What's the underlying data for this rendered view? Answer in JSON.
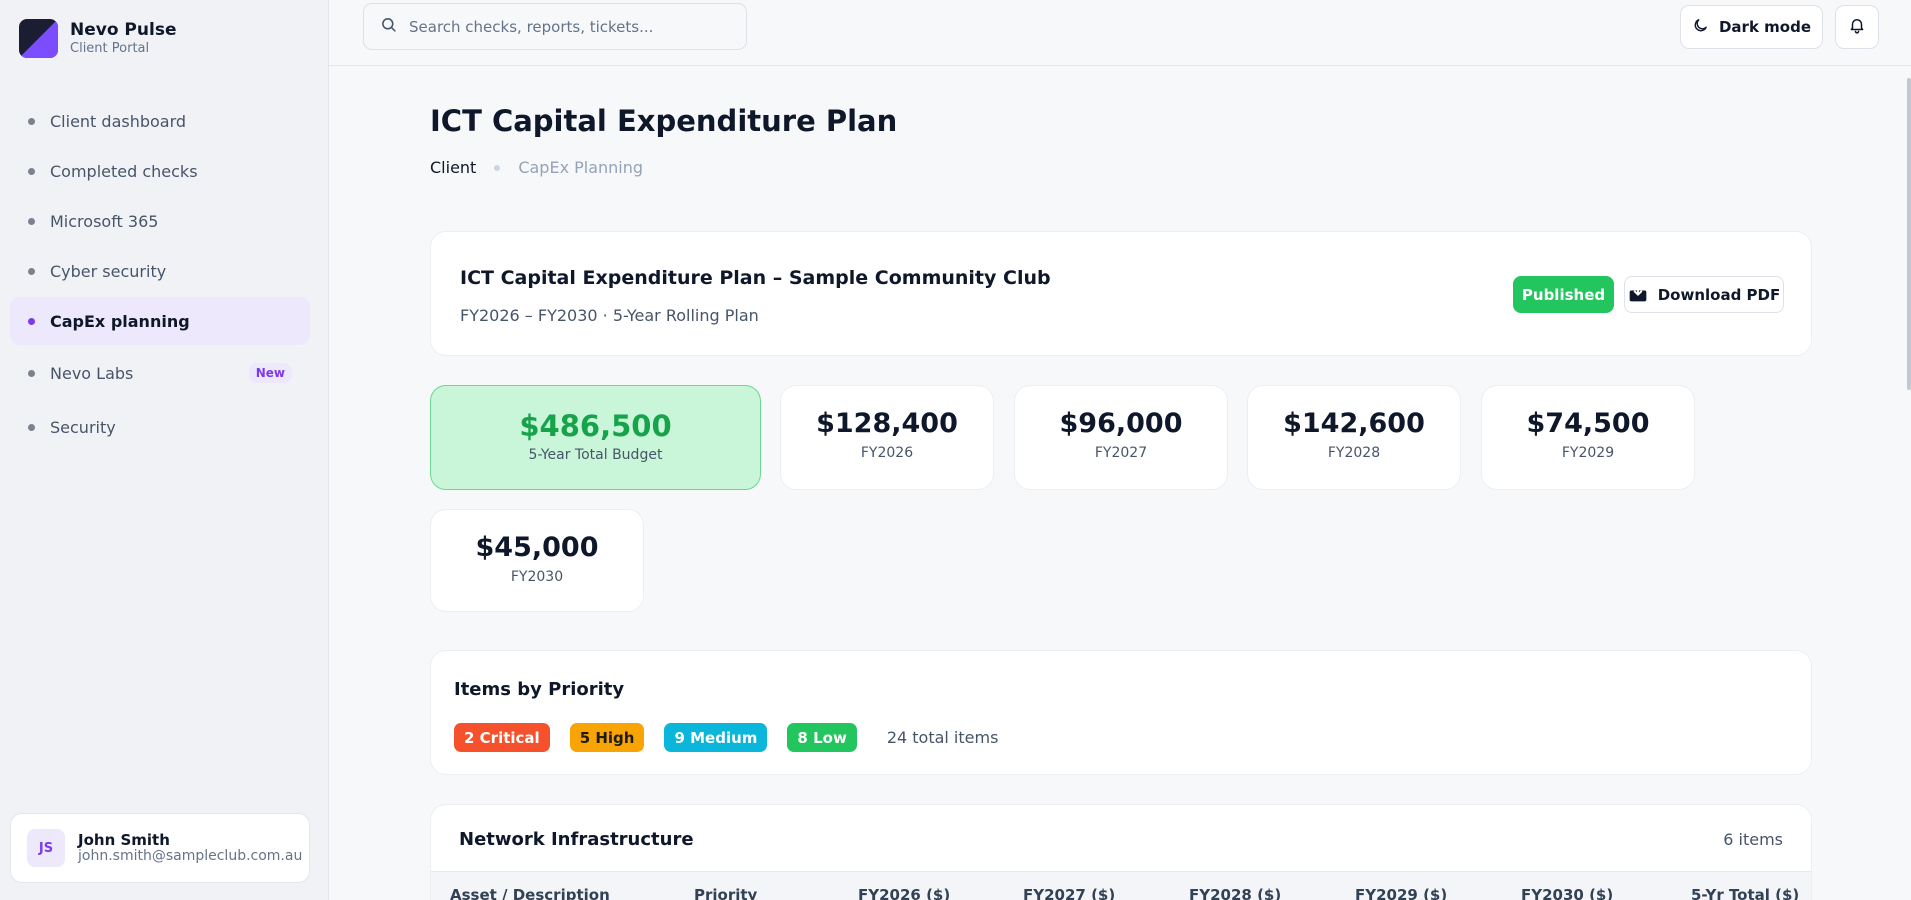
{
  "brand": {
    "name": "Nevo Pulse",
    "subtitle": "Client Portal",
    "logo_colors": [
      "#1b1e33",
      "#7c4dff"
    ]
  },
  "nav": {
    "items": [
      {
        "label": "Client dashboard"
      },
      {
        "label": "Completed checks"
      },
      {
        "label": "Microsoft 365"
      },
      {
        "label": "Cyber security"
      },
      {
        "label": "CapEx planning",
        "active": true
      },
      {
        "label": "Nevo Labs",
        "badge": "New"
      },
      {
        "label": "Security"
      }
    ]
  },
  "user": {
    "initials": "JS",
    "name": "John Smith",
    "email": "john.smith@sampleclub.com.au"
  },
  "topbar": {
    "search_placeholder": "Search checks, reports, tickets...",
    "dark_mode_label": "Dark mode",
    "icons": [
      "search-icon",
      "moon-icon",
      "bell-icon"
    ]
  },
  "page": {
    "title": "ICT Capital Expenditure Plan",
    "breadcrumb": [
      "Client",
      "CapEx Planning"
    ]
  },
  "plan": {
    "title": "ICT Capital Expenditure Plan – Sample Community Club",
    "subtitle": "FY2026 – FY2030 · 5-Year Rolling Plan",
    "status": "Published",
    "download_label": "Download PDF"
  },
  "budget": {
    "total": {
      "value": "$486,500",
      "label": "5-Year Total Budget"
    },
    "years": [
      {
        "value": "$128,400",
        "label": "FY2026"
      },
      {
        "value": "$96,000",
        "label": "FY2027"
      },
      {
        "value": "$142,600",
        "label": "FY2028"
      },
      {
        "value": "$74,500",
        "label": "FY2029"
      },
      {
        "value": "$45,000",
        "label": "FY2030"
      }
    ]
  },
  "priority": {
    "title": "Items by Priority",
    "pills": [
      {
        "label": "2 Critical",
        "color": "#f4512c"
      },
      {
        "label": "5 High",
        "color": "#f9a405"
      },
      {
        "label": "9 Medium",
        "color": "#0ab6d9"
      },
      {
        "label": "8 Low",
        "color": "#22c55e"
      }
    ],
    "total": "24 total items"
  },
  "network": {
    "title": "Network Infrastructure",
    "count": "6 items",
    "columns": [
      "Asset / Description",
      "Priority",
      "FY2026 ($)",
      "FY2027 ($)",
      "FY2028 ($)",
      "FY2029 ($)",
      "FY2030 ($)",
      "5-Yr Total ($)"
    ]
  },
  "colors": {
    "accent": "#7c3aed",
    "success": "#22c55e",
    "total_bg": "#c9f5d8"
  }
}
